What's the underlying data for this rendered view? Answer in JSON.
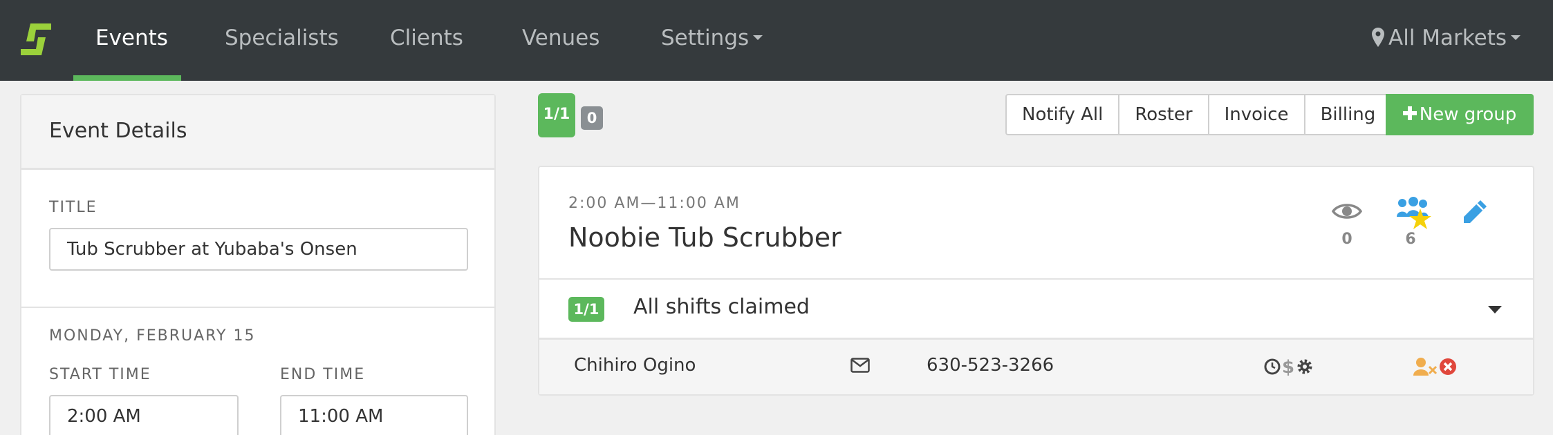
{
  "nav": {
    "items": [
      {
        "label": "Events",
        "active": true
      },
      {
        "label": "Specialists"
      },
      {
        "label": "Clients"
      },
      {
        "label": "Venues"
      },
      {
        "label": "Settings",
        "dropdown": true
      }
    ],
    "market_label": "All Markets",
    "icons": {
      "logo": "brand-logo-icon",
      "market": "map-marker-icon"
    }
  },
  "colors": {
    "navbar": "#353a3d",
    "accent_green": "#5cb85c",
    "info_blue": "#3aa0e3",
    "star_yellow": "#f5d10a",
    "warn_orange": "#f0ad4e",
    "danger_red": "#e0473c"
  },
  "event_details": {
    "heading": "Event Details",
    "title_label": "TITLE",
    "title_value": "Tub Scrubber at Yubaba's Onsen",
    "date_label": "MONDAY, FEBRUARY 15",
    "start_label": "START TIME",
    "start_value": "2:00 AM",
    "end_label": "END TIME",
    "end_value": "11:00 AM"
  },
  "toolbar": {
    "filled_badge": "1/1",
    "pending_badge": "0",
    "buttons": [
      "Notify All",
      "Roster",
      "Invoice",
      "Billing"
    ],
    "new_group_label": "New group"
  },
  "group": {
    "time_range": "2:00 AM—11:00 AM",
    "name": "Noobie Tub Scrubber",
    "views_count": "0",
    "favorites_count": "6",
    "shift_badge": "1/1",
    "shift_status": "All shifts claimed",
    "worker": {
      "name": "Chihiro Ogino",
      "phone": "630-523-3266"
    }
  }
}
